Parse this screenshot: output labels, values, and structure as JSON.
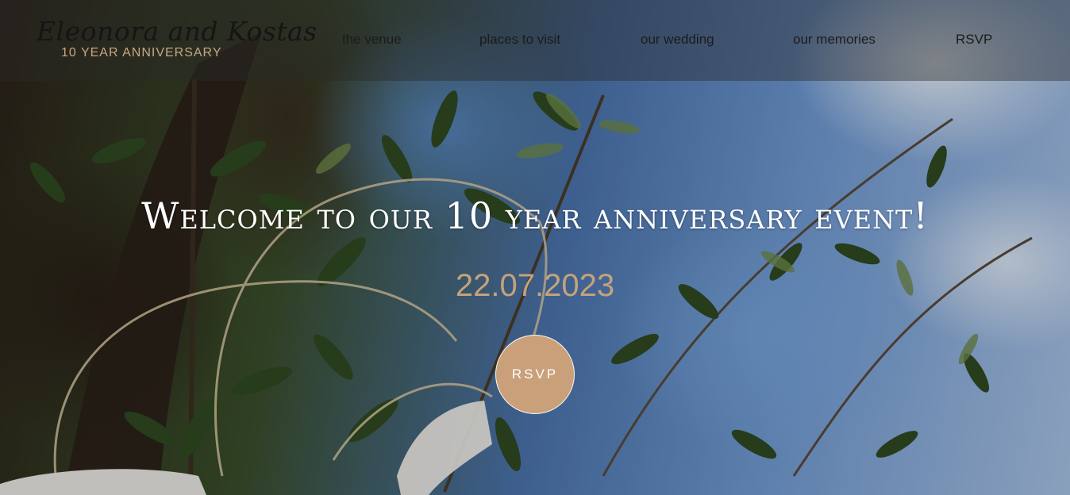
{
  "brand": {
    "name": "Eleonora and Kostas",
    "subtitle": "10 YEAR ANNIVERSARY"
  },
  "nav": {
    "items": [
      {
        "label": "the venue"
      },
      {
        "label": "places to visit"
      },
      {
        "label": "our wedding"
      },
      {
        "label": "our memories"
      },
      {
        "label": "RSVP"
      }
    ]
  },
  "hero": {
    "headline": "Welcome to our 10 year anniversary event!",
    "date": "22.07.2023",
    "rsvp_button": "RSVP"
  },
  "colors": {
    "accent": "#c9a07a",
    "topbar_overlay": "rgba(40,40,40,0.42)",
    "headline": "#ffffff"
  }
}
